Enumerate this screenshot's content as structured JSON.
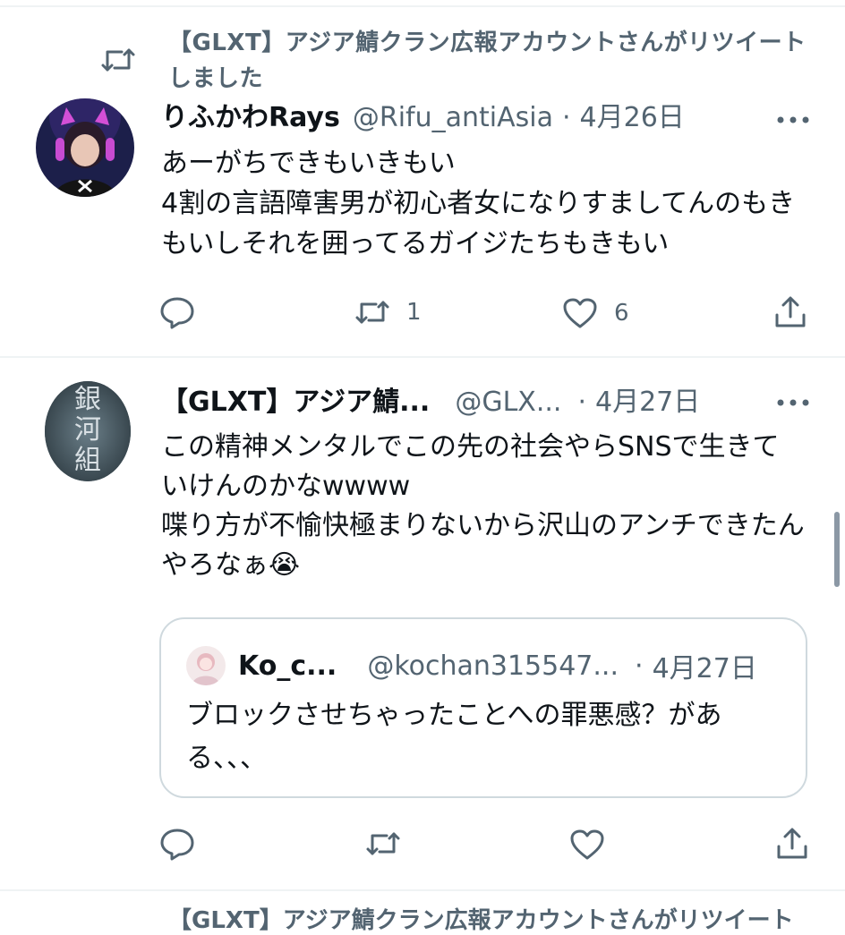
{
  "retweet_context": {
    "text": "【GLXT】アジア鯖クラン広報アカウントさんがリツイートしました",
    "icon": "retweet-icon"
  },
  "tweet1": {
    "display_name": "りふかわRays",
    "handle": "@Rifu_antiAsia",
    "separator": "·",
    "date": "4月26日",
    "text": "あーがちできもいきもい\n4割の言語障害男が初心者女になりすましてんのもきもいしそれを囲ってるガイジたちもきもい",
    "actions": {
      "reply_count": "",
      "retweet_count": "1",
      "like_count": "6"
    }
  },
  "tweet2": {
    "display_name": "【GLXT】アジア鯖...",
    "handle": "@GLX...",
    "separator": "·",
    "date": "4月27日",
    "avatar_text": "銀河組",
    "text": "この精神メンタルでこの先の社会やらSNSで生きていけんのかなwwww\n喋り方が不愉快極まりないから沢山のアンチできたんやろなぁ😭",
    "quote": {
      "display_name": "Ko_c...",
      "handle": "@kochan315547...",
      "separator": "·",
      "date": "4月27日",
      "text": "ブロックさせちゃったことへの罪悪感？がある、、、"
    }
  },
  "next_partial": {
    "text": "【GLXT】アジア鯖クラン広報アカウントさんがリツイート"
  },
  "colors": {
    "text_primary": "#0f1419",
    "text_secondary": "#536471",
    "border": "#cfd9de",
    "divider": "#eff3f4"
  }
}
